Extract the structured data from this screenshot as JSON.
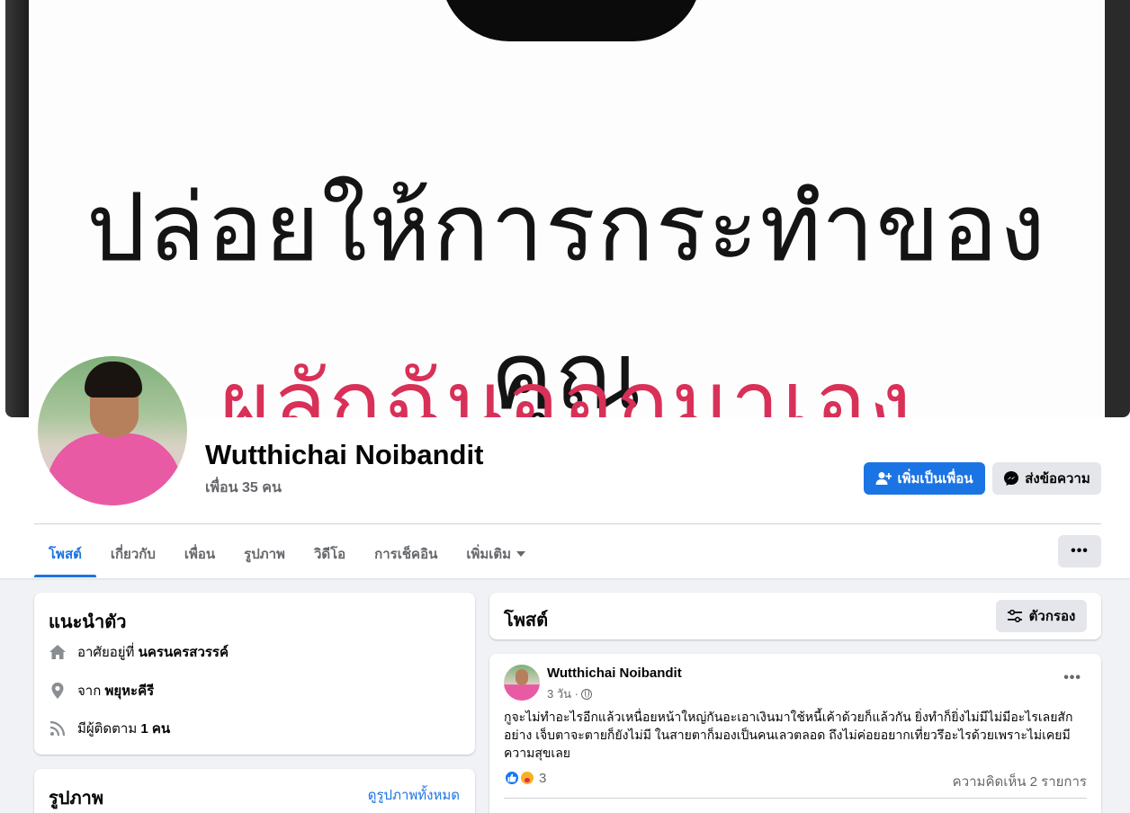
{
  "cover": {
    "line1": "ปล่อยให้การกระทำของคุณ",
    "line2": "ผลักฉันออกมาเอง"
  },
  "profile": {
    "name": "Wutthichai Noibandit",
    "friends": "เพื่อน 35 คน"
  },
  "actions": {
    "add_friend": "เพิ่มเป็นเพื่อน",
    "message": "ส่งข้อความ"
  },
  "tabs": [
    {
      "label": "โพสต์",
      "active": true
    },
    {
      "label": "เกี่ยวกับ"
    },
    {
      "label": "เพื่อน"
    },
    {
      "label": "รูปภาพ"
    },
    {
      "label": "วิดีโอ"
    },
    {
      "label": "การเช็คอิน"
    },
    {
      "label": "เพิ่มเติม"
    }
  ],
  "more_label": "•••",
  "intro": {
    "title": "แนะนำตัว",
    "lives_prefix": "อาศัยอยู่ที่",
    "lives_place": "นครนครสวรรค์",
    "from_prefix": "จาก",
    "from_place": "พยุหะคีรี",
    "followers_prefix": "มีผู้ติดตาม",
    "followers_count": "1 คน"
  },
  "photos": {
    "title": "รูปภาพ",
    "see_all": "ดูรูปภาพทั้งหมด"
  },
  "posts_header": {
    "title": "โพสต์",
    "filter": "ตัวกรอง"
  },
  "post": {
    "author": "Wutthichai Noibandit",
    "time": "3 วัน ·",
    "text": "กูจะไม่ทำอะไรอีกแล้วเหนื่อยหน้าใหญ่กันอะเอาเงินมาใช้หนี้เค้าด้วยก็แล้วกัน ยิ่งทำก็ยิ่งไม่มีไม่มีอะไรเลยสักอย่าง เจ็บตาจะตายก็ยังไม่มี ในสายตาก็มองเป็นคนเลวตลอด ถึงไม่ค่อยอยากเที่ยวรึอะไรด้วยเพราะไม่เคยมีความสุขเลย",
    "reaction_count": "3",
    "comments": "ความคิดเห็น 2 รายการ",
    "more": "•••"
  },
  "colors": {
    "accent": "#1b74e4",
    "secondary_button": "#e4e6eb",
    "page_bg": "#f0f2f5",
    "cover_red_text": "#d93058"
  }
}
